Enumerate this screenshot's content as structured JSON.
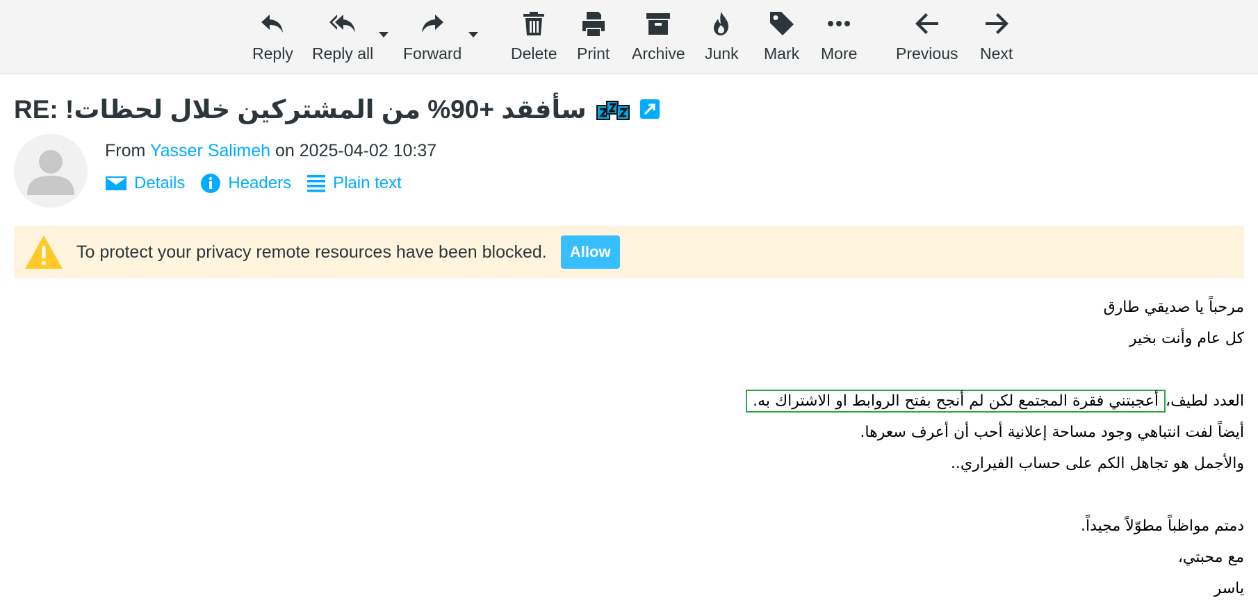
{
  "toolbar": {
    "reply": "Reply",
    "reply_all": "Reply all",
    "forward": "Forward",
    "delete": "Delete",
    "print": "Print",
    "archive": "Archive",
    "junk": "Junk",
    "mark": "Mark",
    "more": "More",
    "previous": "Previous",
    "next": "Next"
  },
  "message": {
    "subject": "RE: !سأفقد +90% من المشتركين خلال لحظات",
    "from_prefix": "From",
    "sender": "Yasser Salimeh",
    "date_prefix": "on",
    "date": "2025-04-02 10:37"
  },
  "header_links": {
    "details": "Details",
    "headers": "Headers",
    "plain_text": "Plain text"
  },
  "privacy": {
    "text": "To protect your privacy remote resources have been blocked.",
    "allow": "Allow"
  },
  "body": {
    "line1": "مرحباً يا صديقي طارق",
    "line2": "كل عام وأنت بخير",
    "line3_prefix": "العدد لطيف،",
    "line3_highlight": "أعجبتني فقرة المجتمع لكن لم أنجح بفتح الروابط او الاشتراك به.",
    "line4": "أيضاً لفت انتباهي وجود مساحة إعلانية أحب أن أعرف سعرها.",
    "line5": "والأجمل هو تجاهل الكم على حساب الفيراري..",
    "line6": "دمتم مواظباً مطوّلاً مجيداً.",
    "line7": "مع محبتي،",
    "line8": "ياسر"
  },
  "colors": {
    "accent": "#00acff",
    "banner_bg": "#fff5de",
    "warning": "#ffca28",
    "highlight_border": "#28a745",
    "allow_bg": "#37beff"
  }
}
